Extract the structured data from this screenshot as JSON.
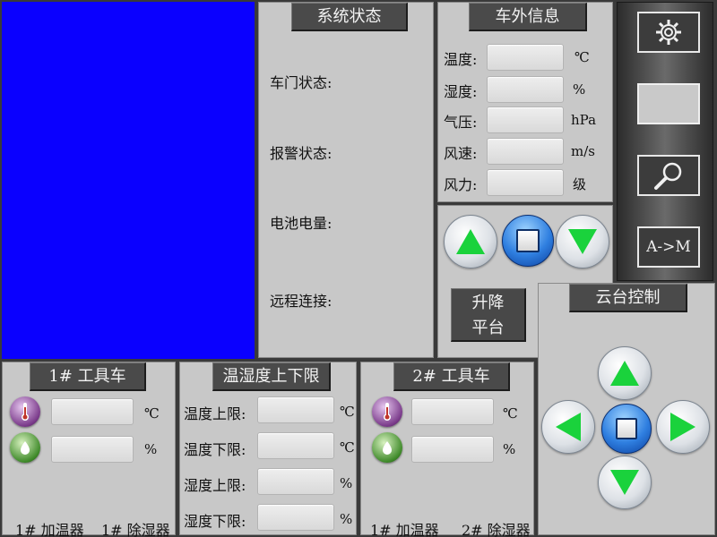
{
  "video": {
    "color": "#0a00ff"
  },
  "system_status": {
    "title": "系统状态",
    "labels": [
      "车门状态:",
      "报警状态:",
      "电池电量:",
      "远程连接:"
    ]
  },
  "outside_info": {
    "title": "车外信息",
    "rows": [
      {
        "label": "温度:",
        "value": "",
        "unit": "℃"
      },
      {
        "label": "湿度:",
        "value": "",
        "unit": "%"
      },
      {
        "label": "气压:",
        "value": "",
        "unit": "hPa"
      },
      {
        "label": "风速:",
        "value": "",
        "unit": "m/s"
      },
      {
        "label": "风力:",
        "value": "",
        "unit": "级"
      }
    ]
  },
  "lift": {
    "label_line1": "升降",
    "label_line2": "平台"
  },
  "toolbar": {
    "mode_label": "A->M",
    "icons": [
      "gear-icon",
      "blank-button",
      "magnifier-icon"
    ]
  },
  "ptz": {
    "title": "云台控制"
  },
  "cart1": {
    "title": "1# 工具车",
    "temp_value": "",
    "temp_unit": "℃",
    "hum_value": "",
    "hum_unit": "%",
    "humidifier": "1# 加温器",
    "dehumidifier": "1# 除湿器"
  },
  "limits": {
    "title": "温湿度上下限",
    "rows": [
      {
        "label": "温度上限:",
        "value": "",
        "unit": "℃"
      },
      {
        "label": "温度下限:",
        "value": "",
        "unit": "℃"
      },
      {
        "label": "湿度上限:",
        "value": "",
        "unit": "%"
      },
      {
        "label": "湿度下限:",
        "value": "",
        "unit": "%"
      }
    ]
  },
  "cart2": {
    "title": "2# 工具车",
    "temp_value": "",
    "temp_unit": "℃",
    "hum_value": "",
    "hum_unit": "%",
    "humidifier": "1# 加温器",
    "dehumidifier": "2# 除湿器"
  }
}
